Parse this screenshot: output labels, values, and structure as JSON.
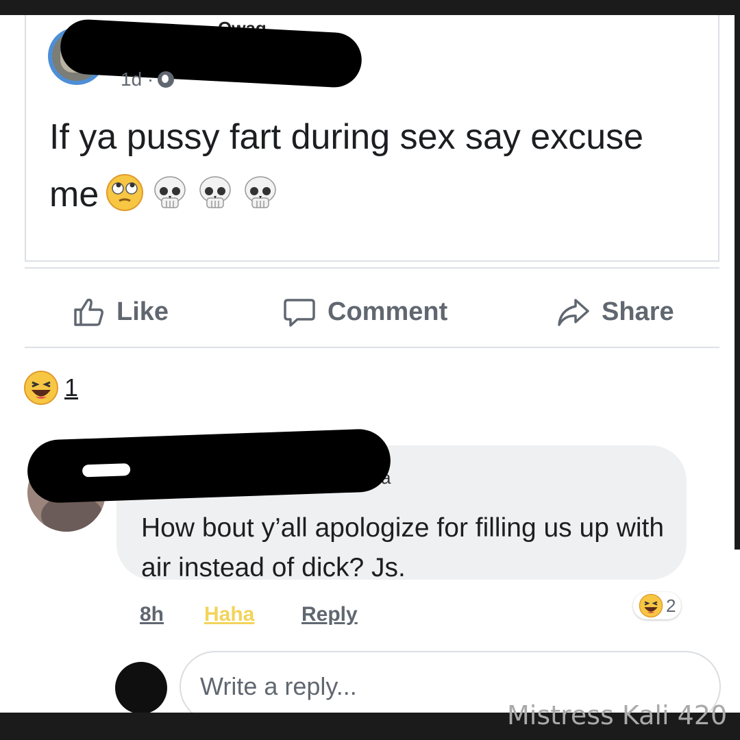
{
  "post": {
    "author_partial": "Owag",
    "time": "1d ·",
    "text": "If ya pussy fart during sex say excuse me",
    "emojis": [
      "face-with-rolling-eyes",
      "skull",
      "skull",
      "skull"
    ]
  },
  "actions": {
    "like": "Like",
    "comment": "Comment",
    "share": "Share"
  },
  "reactions": {
    "icon": "haha",
    "count": "1"
  },
  "comment": {
    "author_partial": "a",
    "text": "How bout y’all apologize for filling us up with air instead of dick? Js.",
    "time": "8h",
    "haha": "Haha",
    "reply": "Reply",
    "reaction_count": "2"
  },
  "reply_box": {
    "placeholder": "Write a reply..."
  },
  "watermark": "Mistress Kali 420",
  "colors": {
    "action_gray": "#606770",
    "text": "#1c1e21",
    "bubble": "#eff0f2",
    "haha_yellow": "#f3d35b",
    "ring_blue": "#4d8ed6"
  }
}
